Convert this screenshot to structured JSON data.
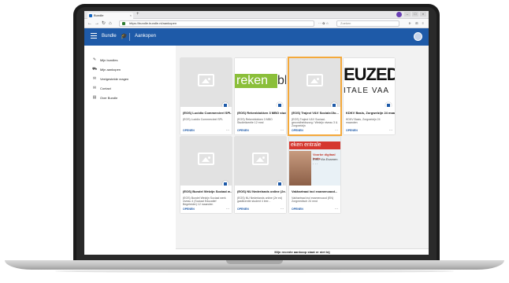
{
  "browser": {
    "tab_title": "Bundle",
    "tab_close": "×",
    "new_tab": "+",
    "back": "←",
    "forward": "→",
    "reload": "↻",
    "home": "⌂",
    "url": "https://bundle.bundle.nl/aankopen",
    "url_tools": "···  ✿  ☆",
    "search_placeholder": "Zoeken",
    "toolbar_icons": "⊪ ⊞ ≡",
    "win_min": "–",
    "win_max": "□",
    "win_close": "×"
  },
  "app": {
    "brand": "Bundle",
    "section": "Aankopen"
  },
  "sidebar": {
    "items": [
      {
        "label": "Mijn bundles",
        "icon": "graduation-cap-icon"
      },
      {
        "label": "Mijn aankopen",
        "icon": "shopping-cart-icon"
      },
      {
        "label": "Veelgestelde vragen",
        "icon": "chat-icon"
      },
      {
        "label": "Contact",
        "icon": "envelope-icon"
      },
      {
        "label": "Over Bundle",
        "icon": "book-icon"
      }
    ]
  },
  "cards": [
    {
      "title": "(EOS) Lucidio Commercieel SPL",
      "subtitle": "(EOS) Lucidio Commercieel SPL",
      "open": "OPENEN",
      "more": "⋯",
      "thumb": "placeholder"
    },
    {
      "title": "(EOS) Rekenblokken 3 MBO studie",
      "subtitle": "(EOS) Rekenblokken 3 MBO Studielicentie 12 mnd",
      "open": "OPENEN",
      "more": "⋯",
      "thumb": "rekenblokken",
      "thumb_text_1": "reken",
      "thumb_text_2": "bl"
    },
    {
      "title": "(EOS) Traject V&V Sociale/Jlo...",
      "subtitle": "(EOS) Traject V&V Sociaal-gezondheidszorg / Welzijn niveau 3 & Zorgwelzijn",
      "open": "OPENEN",
      "more": "⋯",
      "thumb": "placeholder",
      "selected": true
    },
    {
      "title": "KDKV Basis, Zorgwelzijn 24 maand...",
      "subtitle": "KDKV Basis, Zorgwelzijn 24 maanden",
      "open": "OPENEN",
      "more": "⋯",
      "thumb": "euzed",
      "thumb_text_1": "EUZED",
      "thumb_text_2": "ITALE VAA"
    },
    {
      "title": "(EOS) Bundel Welzijn Sociaal w...",
      "subtitle": "(EOS) Bundel Welzijn Sociaal werk niveau 4 (Sociaal Educatief Begeleider) 12 maanden",
      "open": "OPENEN",
      "more": "⋯",
      "thumb": "placeholder"
    },
    {
      "title": "(EOS) NU Nederlands online (2e...",
      "subtitle": "(EOS) NU Nederlands online (2e ed) gastlicentie student 4 leer...",
      "open": "OPENEN",
      "more": "⋯",
      "thumb": "placeholder"
    },
    {
      "title": "Vakhartraai incl examencaod...",
      "subtitle": "Vakhartraai incl examencaod (EN) Zorgmedisch 24 mnd",
      "open": "OPENEN",
      "more": "⋯",
      "thumb": "examencentrale",
      "thumb_text_1": "eken entrale",
      "thumb_text_2": "Voorbe digitaal toets",
      "thumb_text_3": "EVA: Via Examen",
      "thumb_text_4": "· · ·"
    }
  ],
  "footer": {
    "text": "Mijn recente aankoop staat er niet bij"
  }
}
